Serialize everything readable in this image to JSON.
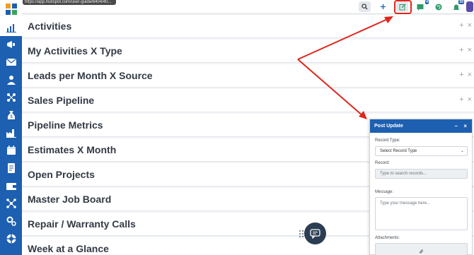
{
  "browser": {
    "status_url": "https://app.hubspot.com/user-guide/6404/40..."
  },
  "topbar": {
    "notification_badge_1": "4",
    "notification_badge_2": "55"
  },
  "sidebar": {
    "items": [
      "logo",
      "chart-icon",
      "megaphone-icon",
      "mail-icon",
      "person-icon",
      "network-icon",
      "money-bag-icon",
      "factory-icon",
      "calendar-icon",
      "document-icon",
      "wallet-icon",
      "hierarchy-icon",
      "settings-icon",
      "support-icon"
    ]
  },
  "dashboard": {
    "rows": [
      {
        "title": "Activities"
      },
      {
        "title": "My Activities X Type"
      },
      {
        "title": "Leads per Month X Source"
      },
      {
        "title": "Sales Pipeline"
      },
      {
        "title": "Pipeline Metrics"
      },
      {
        "title": "Estimates X Month"
      },
      {
        "title": "Open Projects"
      },
      {
        "title": "Master Job Board"
      },
      {
        "title": "Repair / Warranty Calls"
      },
      {
        "title": "Week at a Glance"
      }
    ],
    "row_controls": "+ ×"
  },
  "post_update": {
    "title": "Post Update",
    "minimize": "–",
    "close": "×",
    "record_type_label": "Record Type:",
    "record_type_value": "Select Record Type",
    "record_label": "Record:",
    "record_placeholder": "Type to search records...",
    "message_label": "Message:",
    "message_placeholder": "Type your message here...",
    "attachments_label": "Attachments:"
  },
  "colors": {
    "sidebar_blue": "#1d5fb0",
    "annotation_red": "#e0251b",
    "chat_button": "#2b3d52"
  }
}
